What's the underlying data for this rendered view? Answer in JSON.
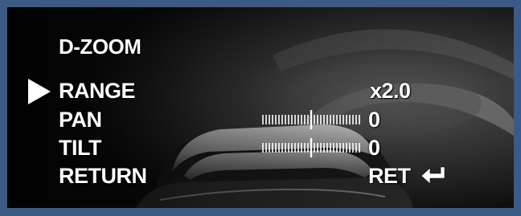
{
  "menu": {
    "title": "D-ZOOM",
    "items": [
      {
        "label": "RANGE",
        "value": "x2.0"
      },
      {
        "label": "PAN",
        "value": "0",
        "level": 0.5
      },
      {
        "label": "TILT",
        "value": "0",
        "level": 0.5
      },
      {
        "label": "RETURN",
        "value": "RET"
      }
    ],
    "selected_index": 0
  },
  "icons": {
    "cursor": "triangle-right-icon",
    "return": "enter-arrow-icon"
  },
  "colors": {
    "frame": "#3c5a86",
    "text": "#ffffff",
    "screen": "#0b0b0b"
  }
}
